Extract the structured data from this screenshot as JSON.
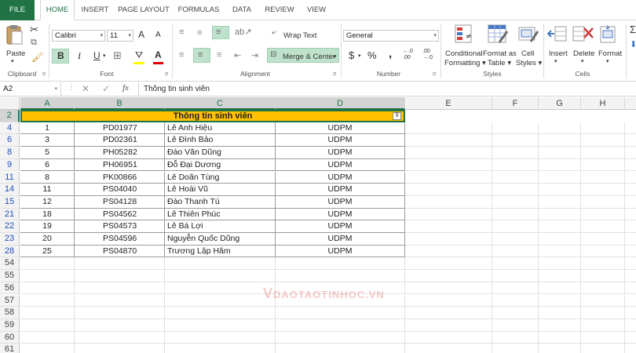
{
  "tabs": [
    "FILE",
    "HOME",
    "INSERT",
    "PAGE LAYOUT",
    "FORMULAS",
    "DATA",
    "REVIEW",
    "VIEW"
  ],
  "ribbon": {
    "clipboard": {
      "paste": "Paste",
      "label": "Clipboard"
    },
    "font": {
      "name": "Calibri",
      "size": "11",
      "bold": "B",
      "italic": "I",
      "underline": "U",
      "grow": "A",
      "shrink": "A",
      "label": "Font"
    },
    "alignment": {
      "wrap_text": "Wrap Text",
      "merge_center": "Merge & Center",
      "label": "Alignment"
    },
    "number": {
      "format": "General",
      "currency": "$",
      "percent": "%",
      "comma": ",",
      "inc_decimal": "←.0\n.00",
      "dec_decimal": ".00\n→.0",
      "label": "Number"
    },
    "styles": {
      "conditional": "Conditional",
      "formatting": "Formatting",
      "format_as": "Format as",
      "table": "Table",
      "cell": "Cell",
      "styles_btn": "Styles",
      "label": "Styles"
    },
    "cells": {
      "insert": "Insert",
      "delete": "Delete",
      "format": "Format",
      "label": "Cells"
    }
  },
  "formula_bar": {
    "name_box": "A2",
    "fx": "fx",
    "content": "Thông tin sinh viên"
  },
  "columns": [
    "A",
    "B",
    "C",
    "D",
    "E",
    "F",
    "G",
    "H"
  ],
  "sheet": {
    "title": "Thông tin sinh viên",
    "rows": [
      {
        "row": "4",
        "a": "1",
        "b": "PD01977",
        "c": "Lê Anh Hiệu",
        "d": "UDPM"
      },
      {
        "row": "6",
        "a": "3",
        "b": "PD02361",
        "c": "Lê Đình Bảo",
        "d": "UDPM"
      },
      {
        "row": "8",
        "a": "5",
        "b": "PH05282",
        "c": "Đào Văn Dũng",
        "d": "UDPM"
      },
      {
        "row": "9",
        "a": "6",
        "b": "PH06951",
        "c": "Đỗ Đại Dương",
        "d": "UDPM"
      },
      {
        "row": "11",
        "a": "8",
        "b": "PK00866",
        "c": "Lê Doãn Tùng",
        "d": "UDPM"
      },
      {
        "row": "14",
        "a": "11",
        "b": "PS04040",
        "c": "Lê Hoài Vũ",
        "d": "UDPM"
      },
      {
        "row": "15",
        "a": "12",
        "b": "PS04128",
        "c": "Đào Thanh Tú",
        "d": "UDPM"
      },
      {
        "row": "21",
        "a": "18",
        "b": "PS04562",
        "c": "Lê Thiên Phúc",
        "d": "UDPM"
      },
      {
        "row": "22",
        "a": "19",
        "b": "PS04573",
        "c": "Lê Bá Lợi",
        "d": "UDPM"
      },
      {
        "row": "23",
        "a": "20",
        "b": "PS04596",
        "c": "Nguyễn Quốc Dũng",
        "d": "UDPM"
      },
      {
        "row": "28",
        "a": "25",
        "b": "PS04870",
        "c": "Trương Lập Hâm",
        "d": "UDPM"
      }
    ],
    "empty_rows": [
      "54",
      "55",
      "56",
      "57",
      "58",
      "59",
      "60",
      "61"
    ]
  },
  "watermark": "DAOTAOTINHOC.VN",
  "colors": {
    "accent": "#217346",
    "header_fill": "#ffc000",
    "filtered_row_num": "#1e4fbf"
  }
}
